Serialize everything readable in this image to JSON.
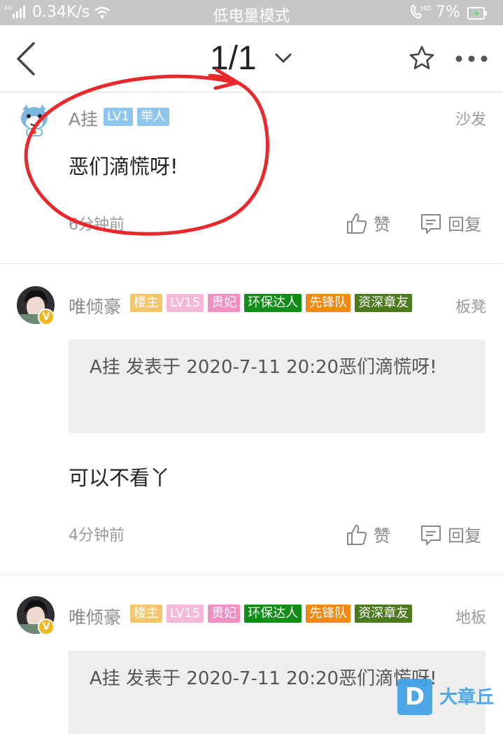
{
  "status_bar": {
    "signal_text": "ⁱ⁶ıl",
    "speed": "0.34K/s",
    "mode": "低电量模式",
    "call_icon_text": "HD",
    "battery_pct": "7%",
    "battery_level": 0.07
  },
  "nav": {
    "page_indicator": "1/1",
    "icons": [
      "back-icon",
      "chevron-down-icon",
      "star-icon",
      "more-icon"
    ]
  },
  "colors": {
    "annotation_red": "#e8282b",
    "badge_lv1": "#8fc6f0",
    "badge_juren": "#8fc6f0",
    "badge_louzhu": "#f5c56b",
    "badge_lv15": "#f5b8d8",
    "badge_guifei": "#f08fc0",
    "badge_huanbao": "#138c1a",
    "badge_xianfeng": "#f08a14",
    "badge_zishen": "#4b7a1f"
  },
  "posts": [
    {
      "user": "A挂",
      "badges": [
        "LV1",
        "举人"
      ],
      "floor": "沙发",
      "content": "恶们滴慌呀!",
      "time": "6分钟前",
      "like_label": "赞",
      "reply_label": "回复"
    },
    {
      "user": "唯倾豪",
      "badges": [
        "楼主",
        "LV15",
        "贵妃",
        "环保达人",
        "先锋队",
        "资深章友"
      ],
      "floor": "板凳",
      "quote": "A挂 发表于 2020-7-11 20:20恶们滴慌呀!",
      "content": "可以不看丫",
      "time": "4分钟前",
      "like_label": "赞",
      "reply_label": "回复"
    },
    {
      "user": "唯倾豪",
      "badges": [
        "楼主",
        "LV15",
        "贵妃",
        "环保达人",
        "先锋队",
        "资深章友"
      ],
      "floor": "地板",
      "quote": "A挂 发表于 2020-7-11 20:20恶们滴慌呀!"
    }
  ],
  "watermark": {
    "logo_letter": "D",
    "text": "大章丘"
  }
}
